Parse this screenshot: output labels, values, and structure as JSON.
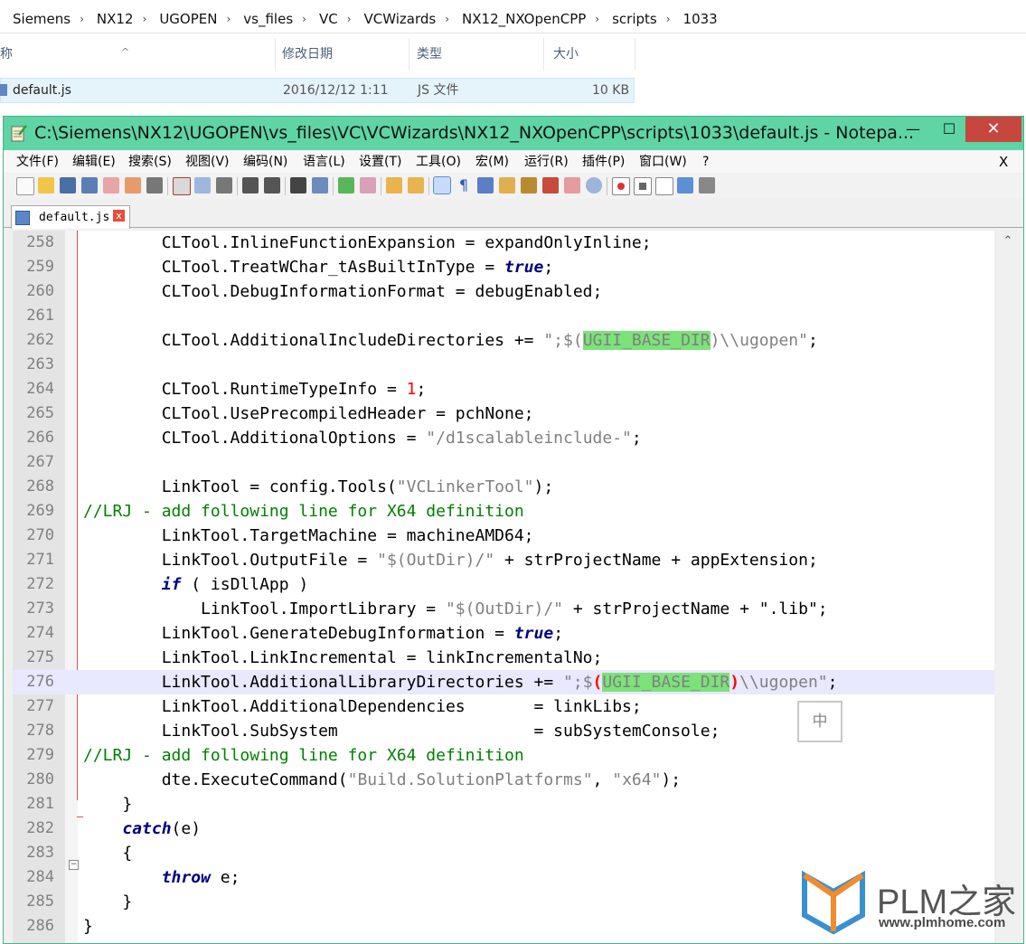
{
  "explorer": {
    "breadcrumb": [
      "Siemens",
      "NX12",
      "UGOPEN",
      "vs_files",
      "VC",
      "VCWizards",
      "NX12_NXOpenCPP",
      "scripts",
      "1033"
    ],
    "columns": {
      "name": "称",
      "date": "修改日期",
      "type": "类型",
      "size": "大小"
    },
    "sort_caret": "^",
    "file": {
      "name": "default.js",
      "date": "2016/12/12 1:11",
      "type": "JS 文件",
      "size": "10 KB"
    }
  },
  "window": {
    "title": "C:\\Siemens\\NX12\\UGOPEN\\vs_files\\VC\\VCWizards\\NX12_NXOpenCPP\\scripts\\1033\\default.js - Notepa...",
    "minimize": "—",
    "maximize": "☐",
    "close": "✕"
  },
  "menu": {
    "items": [
      "文件(F)",
      "编辑(E)",
      "搜索(S)",
      "视图(V)",
      "编码(N)",
      "语言(L)",
      "设置(T)",
      "工具(O)",
      "宏(M)",
      "运行(R)",
      "插件(P)",
      "窗口(W)",
      "?"
    ],
    "close_doc": "X"
  },
  "tab": {
    "label": "default.js",
    "close": "x"
  },
  "editor": {
    "lines": [
      {
        "n": "258",
        "t": "        CLTool.InlineFunctionExpansion = expandOnlyInline;"
      },
      {
        "n": "259",
        "t": "        CLTool.TreatWChar_tAsBuiltInType = ",
        "kw": "true",
        "after": ";"
      },
      {
        "n": "260",
        "t": "        CLTool.DebugInformationFormat = debugEnabled;"
      },
      {
        "n": "261",
        "t": ""
      },
      {
        "n": "262",
        "t": "        CLTool.AdditionalIncludeDirectories += ",
        "s1": "\";$(",
        "hl": "UGII_BASE_DIR",
        "s2": ")\\\\ugopen\"",
        "after": ";"
      },
      {
        "n": "263",
        "t": ""
      },
      {
        "n": "264",
        "t": "        CLTool.RuntimeTypeInfo = ",
        "num": "1",
        "after": ";"
      },
      {
        "n": "265",
        "t": "        CLTool.UsePrecompiledHeader = pchNone;"
      },
      {
        "n": "266",
        "t": "        CLTool.AdditionalOptions = ",
        "s1": "\"/d1scalableinclude-\"",
        "after": ";"
      },
      {
        "n": "267",
        "t": ""
      },
      {
        "n": "268",
        "t": "        LinkTool = config.Tools(",
        "s1": "\"VCLinkerTool\"",
        "after": ");"
      },
      {
        "n": "269",
        "cm": "//LRJ - add following line for X64 definition"
      },
      {
        "n": "270",
        "t": "        LinkTool.TargetMachine = machineAMD64;"
      },
      {
        "n": "271",
        "t": "        LinkTool.OutputFile = ",
        "s1": "\"$(OutDir)/\"",
        "after": " + strProjectName + appExtension;"
      },
      {
        "n": "272",
        "t": "        ",
        "kw": "if",
        "after": " ( isDllApp )"
      },
      {
        "n": "273",
        "t": "            LinkTool.ImportLibrary = ",
        "s1": "\"$(OutDir)/\"",
        "after": " + strProjectName + \".lib\";"
      },
      {
        "n": "274",
        "t": "        LinkTool.GenerateDebugInformation = ",
        "kw": "true",
        "after": ";"
      },
      {
        "n": "275",
        "t": "        LinkTool.LinkIncremental = linkIncrementalNo;"
      },
      {
        "n": "276",
        "t": "        LinkTool.AdditionalLibraryDirectories += ",
        "s1": "\";$",
        "br1": "(",
        "hl": "UGII_BASE_DIR",
        "br2": ")",
        "s2": "\\\\ugopen\"",
        "after": ";",
        "current": true
      },
      {
        "n": "277",
        "t": "        LinkTool.AdditionalDependencies       = linkLibs;"
      },
      {
        "n": "278",
        "t": "        LinkTool.SubSystem                    = subSystemConsole;"
      },
      {
        "n": "279",
        "cm": "//LRJ - add following line for X64 definition"
      },
      {
        "n": "280",
        "t": "        dte.ExecuteCommand(",
        "s1": "\"Build.SolutionPlatforms\"",
        "after": ", ",
        "s2": "\"x64\"",
        "after2": ");"
      },
      {
        "n": "281",
        "t": "    }"
      },
      {
        "n": "282",
        "t": "    ",
        "kw": "catch",
        "after": "(e)"
      },
      {
        "n": "283",
        "t": "    {"
      },
      {
        "n": "284",
        "t": "        ",
        "kw": "throw",
        "after": " e;"
      },
      {
        "n": "285",
        "t": "    }"
      },
      {
        "n": "286",
        "t": "}"
      }
    ]
  },
  "ime": {
    "label": "中"
  },
  "watermark": {
    "brand": "PLM之家",
    "url": "www.plmhome.com"
  },
  "colors": {
    "titlebar": "#5fd4a4",
    "close": "#c7463e",
    "keyword": "#000080",
    "string": "#808080",
    "comment": "#008000",
    "highlight": "#7ce27a"
  }
}
